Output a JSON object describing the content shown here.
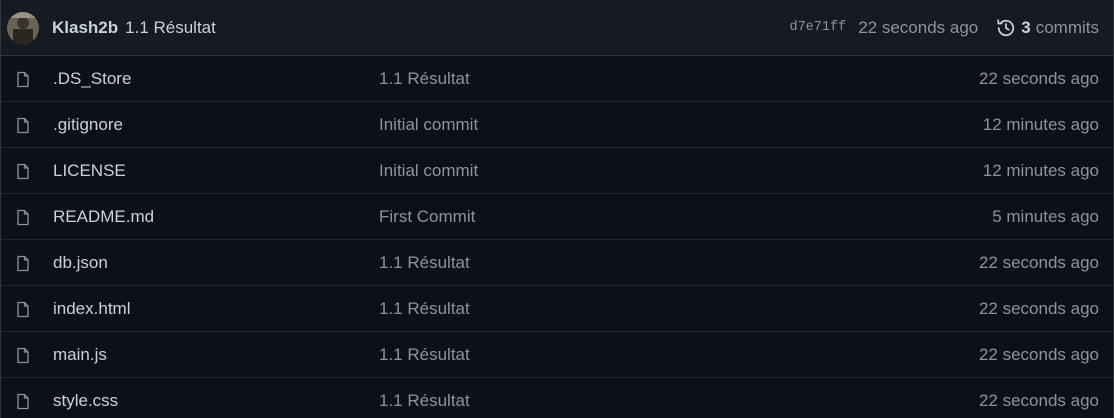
{
  "latest_commit": {
    "author": "Klash2b",
    "message": "1.1 Résultat",
    "sha": "d7e71ff",
    "time": "22 seconds ago",
    "commits_count": "3",
    "commits_label": "commits"
  },
  "files": [
    {
      "name": ".DS_Store",
      "commit": "1.1 Résultat",
      "time": "22 seconds ago"
    },
    {
      "name": ".gitignore",
      "commit": "Initial commit",
      "time": "12 minutes ago"
    },
    {
      "name": "LICENSE",
      "commit": "Initial commit",
      "time": "12 minutes ago"
    },
    {
      "name": "README.md",
      "commit": "First Commit",
      "time": "5 minutes ago"
    },
    {
      "name": "db.json",
      "commit": "1.1 Résultat",
      "time": "22 seconds ago"
    },
    {
      "name": "index.html",
      "commit": "1.1 Résultat",
      "time": "22 seconds ago"
    },
    {
      "name": "main.js",
      "commit": "1.1 Résultat",
      "time": "22 seconds ago"
    },
    {
      "name": "style.css",
      "commit": "1.1 Résultat",
      "time": "22 seconds ago"
    }
  ],
  "icons": {
    "file": "file-icon",
    "history": "history-icon"
  },
  "colors": {
    "background": "#0d1117",
    "header_background": "#161b22",
    "border": "#30363d",
    "text": "#c9d1d9",
    "muted": "#8b949e"
  }
}
